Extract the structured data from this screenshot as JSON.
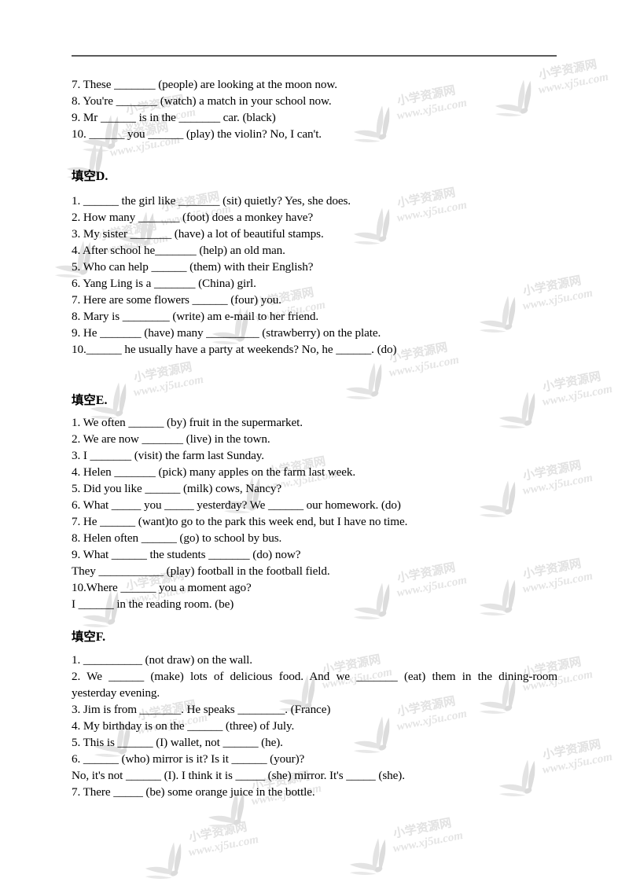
{
  "document": {
    "type": "worksheet",
    "language": "English grammar fill-in-the-blank exercises with Chinese section headings"
  },
  "watermark": {
    "cn_text": "小学资源网",
    "url_text": "www.xj5u.com",
    "logo_name": "bird-leaf-logo",
    "color": "#e3e3e3"
  },
  "carryover": {
    "lines": [
      "7. These _______ (people) are looking at the moon now.",
      "8. You're _______ (watch) a match in your school now.",
      "9. Mr ______ is in the _______ car. (black)",
      "10. ______ you ______ (play) the violin? No, I can't."
    ]
  },
  "sections": [
    {
      "heading_cjk": "填空",
      "heading_latin": "D.",
      "lines": [
        "1. ______ the girl like _______ (sit) quietly?    Yes, she does.",
        "2. How many _______ (foot) does a monkey have?",
        "3. My sister _______ (have) a lot of beautiful stamps.",
        "4. After school he_______ (help) an old man.",
        "5. Who can help ______ (them) with their English?",
        "6. Yang Ling is a _______ (China) girl.",
        "7. Here are some flowers ______ (four) you.",
        "8. Mary is ________ (write) am e-mail to her friend.",
        "9. He _______ (have) many _________ (strawberry) on the plate.",
        "10.______ he usually have a party at weekends?    No, he ______. (do)"
      ]
    },
    {
      "heading_cjk": "填空",
      "heading_latin": "E.",
      "lines": [
        "1. We often ______ (by) fruit in the supermarket.",
        "2. We are now _______ (live) in the town.",
        "3. I _______ (visit) the farm last Sunday.",
        "4. Helen _______ (pick) many apples on the farm last week.",
        "5. Did you like ______ (milk) cows, Nancy?",
        "6. What _____ you _____ yesterday?    We ______ our homework. (do)",
        "7. He ______ (want)to go to the park this week end, but I have no time.",
        "8. Helen often ______ (go) to school by bus.",
        "9. What ______ the students _______ (do) now?",
        "They ___________ (play) football in the football field.",
        "10.Where ______ you a moment ago?",
        "I ______ in the reading room. (be)"
      ]
    },
    {
      "heading_cjk": "填空",
      "heading_latin": "F.",
      "lines": [
        "1. __________ (not draw) on the wall.",
        "2. We ______ (make) lots of delicious food. And we _______ (eat) them in the dining-room",
        "yesterday evening.",
        "3. Jim is from _______. He speaks ________. (France)",
        "4. My birthday is on the ______ (three) of July.",
        "5. This is ______ (I) wallet, not ______ (he).",
        "6. ______ (who) mirror is it? Is it ______ (your)?",
        "No, it's not ______ (I). I think it is _____ (she) mirror. It's _____ (she).",
        "7. There _____ (be) some orange juice in the bottle."
      ]
    }
  ]
}
